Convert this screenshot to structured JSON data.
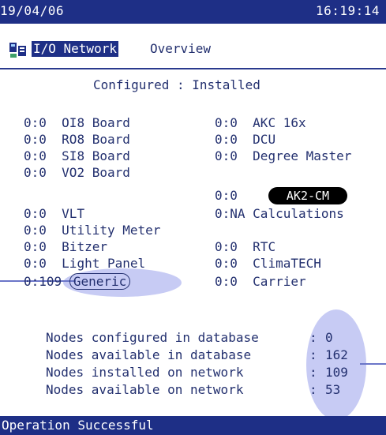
{
  "header": {
    "date": "19/04/06",
    "time": "16:19:14"
  },
  "title": {
    "highlighted": "I/O Network",
    "rest": "Overview",
    "icon": "network-icon"
  },
  "column_header": "Configured : Installed",
  "left_items": [
    {
      "status": "0:0",
      "name": "OI8 Board"
    },
    {
      "status": "0:0",
      "name": "RO8 Board"
    },
    {
      "status": "0:0",
      "name": "SI8 Board"
    },
    {
      "status": "0:0",
      "name": "VO2 Board"
    },
    {
      "status": "0:0",
      "name": "VLT"
    },
    {
      "status": "0:0",
      "name": "Utility Meter"
    },
    {
      "status": "0:0",
      "name": "Bitzer"
    },
    {
      "status": "0:0",
      "name": "Light Panel"
    },
    {
      "status": "0:109",
      "name": "Generic"
    }
  ],
  "right_items": [
    {
      "status": "0:0",
      "name": "AKC 16x"
    },
    {
      "status": "0:0",
      "name": "DCU"
    },
    {
      "status": "0:0",
      "name": "Degree Master"
    },
    {
      "status": "0:0",
      "name": "AK2-CM"
    },
    {
      "status": "0:NA",
      "name": "Calculations"
    },
    {
      "status": "0:0",
      "name": "RTC"
    },
    {
      "status": "0:0",
      "name": "ClimaTECH"
    },
    {
      "status": "0:0",
      "name": "Carrier"
    }
  ],
  "summary": [
    {
      "label": "Nodes configured in database",
      "value": "0"
    },
    {
      "label": "Nodes available in database",
      "value": "162"
    },
    {
      "label": "Nodes installed on network",
      "value": "109"
    },
    {
      "label": "Nodes available on network",
      "value": "53"
    }
  ],
  "status_bar": "Operation Successful",
  "colors": {
    "bar": "#1e2f86",
    "text": "#23306f",
    "highlight": "#8c96e6"
  }
}
